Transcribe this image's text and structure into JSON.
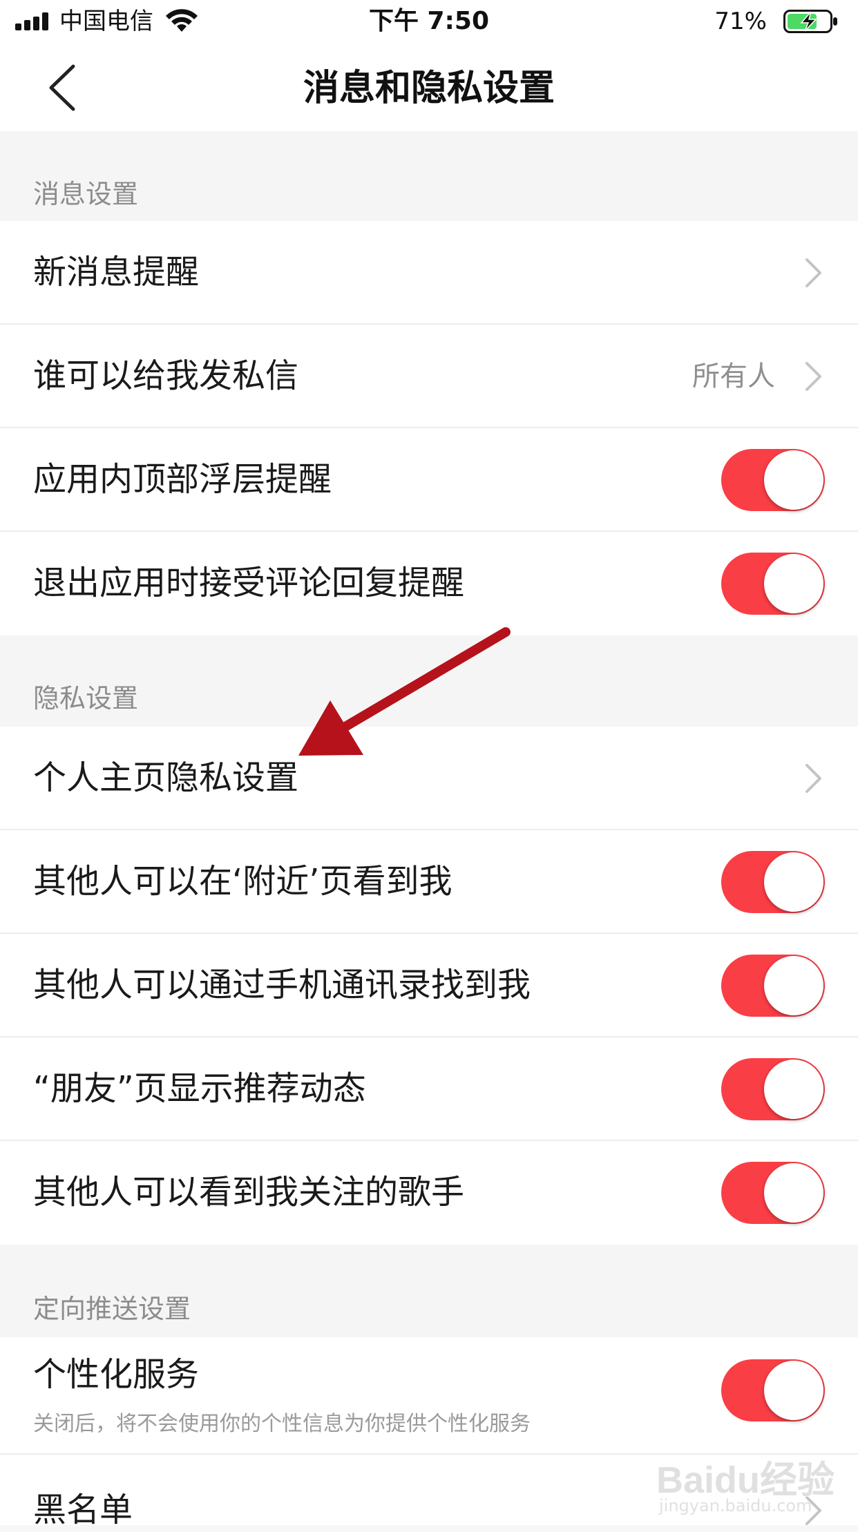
{
  "status_bar": {
    "carrier": "中国电信",
    "time": "下午 7:50",
    "battery_percent": "71%",
    "battery_level": 0.71,
    "battery_color": "#4cd964"
  },
  "nav": {
    "title": "消息和隐私设置",
    "back_icon": "chevron-left-icon"
  },
  "sections": {
    "message": {
      "header": "消息设置",
      "new_message_reminder": "新消息提醒",
      "who_can_message": "谁可以给我发私信",
      "who_can_message_value": "所有人",
      "in_app_banner": "应用内顶部浮层提醒",
      "comment_reply_on_exit": "退出应用时接受评论回复提醒"
    },
    "privacy": {
      "header": "隐私设置",
      "profile_privacy": "个人主页隐私设置",
      "visible_nearby": "其他人可以在‘附近’页看到我",
      "find_by_contacts": "其他人可以通过手机通讯录找到我",
      "friends_recommend": "“朋友”页显示推荐动态",
      "see_followed_artists": "其他人可以看到我关注的歌手"
    },
    "targeted": {
      "header": "定向推送设置",
      "personalized_service": "个性化服务",
      "personalized_desc": "关闭后，将不会使用你的个性信息为你提供个性化服务",
      "blacklist": "黑名单"
    }
  },
  "toggles": {
    "in_app_banner": true,
    "comment_reply_on_exit": true,
    "visible_nearby": true,
    "find_by_contacts": true,
    "friends_recommend": true,
    "see_followed_artists": true,
    "personalized_service": true
  },
  "colors": {
    "toggle_on": "#fa3e45",
    "annotation_arrow": "#b5121b"
  },
  "watermark": {
    "logo": "Baidu经验",
    "url": "jingyan.baidu.com"
  }
}
